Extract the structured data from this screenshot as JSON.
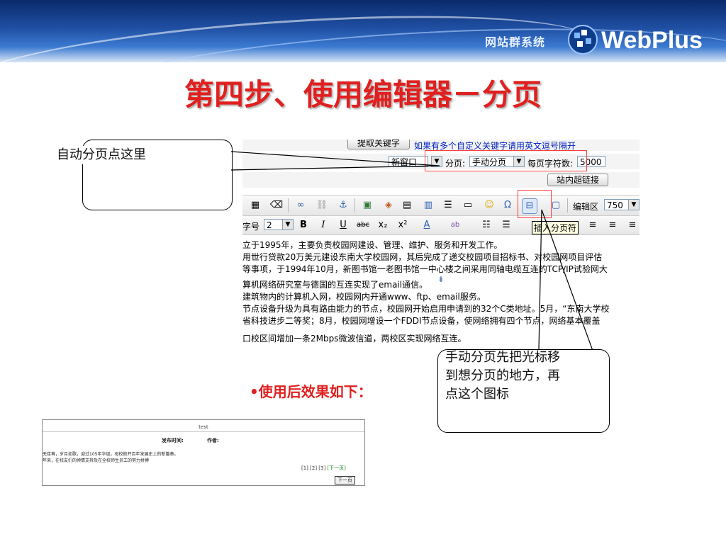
{
  "header": {
    "site_label": "网站群系统",
    "logo_text": "WebPlus"
  },
  "slide": {
    "title": "第四步、使用编辑器－分页",
    "bullet": "•使用后效果如下："
  },
  "callouts": {
    "auto_page": "自动分页点这里",
    "manual_page": [
      "手动分页先把光标移",
      "到想分页的地方，再",
      "点这个图标"
    ]
  },
  "editor": {
    "keyword_button": "提取关键字",
    "keyword_hint": "如果有多个自定义关键字请用英文逗号隔开",
    "window_select": "新窗口",
    "paging_label": "分页:",
    "paging_select": "手动分页",
    "chars_label": "每页字符数:",
    "chars_value": "5000",
    "internal_link_button": "站内超链接",
    "edit_area_label": "编辑区",
    "edit_area_value": "750",
    "font_size_label": "字号",
    "font_size_value": "2",
    "format_buttons": [
      "B",
      "I",
      "U",
      "abc",
      "x₂",
      "x²"
    ],
    "tooltip": "插入分页符",
    "content_lines": [
      "立于1995年，主要负责校园网建设、管理、维护、服务和开发工作。",
      "用世行贷款20万美元建设东南大学校园网，其后完成了递交校园项目招标书、对校园网项目评估",
      "等事项，于1994年10月，新图书馆一老图书馆一中心楼之间采用同轴电缆互连的TCP/IP试验网大",
      "算机网络研究室与德国的互连实现了email通信。",
      "建筑物内的计算机入网，校园网内开通www、ftp、email服务。",
      "节点设备升级为具有路由能力的节点，校园网开始启用申请到的32个C类地址。5月，“东南大学校",
      "省科技进步二等奖；8月，校园网增设一个FDDI节点设备，使网络拥有四个节点，网络基本覆盖",
      "口校区间增加一条2Mbps微波信道，两校区实现网络互连。"
    ]
  },
  "result": {
    "title": "test",
    "publish_time_label": "发布时间:",
    "author_label": "作者:",
    "lines": [
      "无荏苒，岁月如歌，迎过105年华诞，母校掀开百年发展史上的新篇章。",
      "年来，在校友们的倾情支持及在全校师生员工的努力拼搏"
    ],
    "pager": "[1] [2] [3]",
    "pager_next": "[下一页]",
    "next_button": "下一页"
  },
  "colors": {
    "title_red": "#e0201f",
    "highlight_red": "#ff3b3b",
    "link_blue": "#0020c0"
  }
}
